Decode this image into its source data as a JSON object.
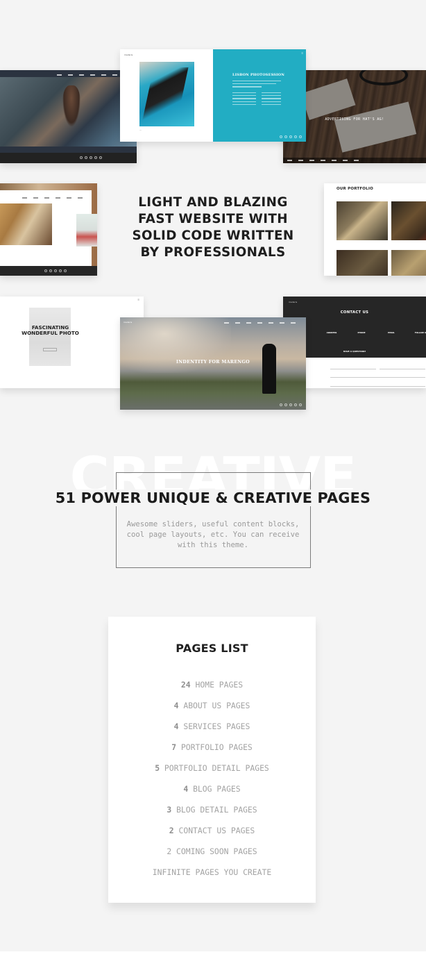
{
  "colors": {
    "background": "#f4f4f4",
    "accent_teal": "#22adc3",
    "heading": "#1e1e1e",
    "muted_text": "#a3a3a3",
    "outline": "#7a7a7a"
  },
  "showcase": {
    "lisbon": {
      "brand": "madaris",
      "title": "LISBON PHOTOSESSION"
    },
    "survival": {
      "headline": "ADVERTISING FOR HAT'S AG!"
    },
    "portfolio": {
      "title": "OUR PORTFOLIO"
    },
    "fascinating": {
      "title_line1": "FASCINATING",
      "title_line2": "WONDERFUL PHOTO"
    },
    "marengo": {
      "brand": "madaris",
      "title": "INDENTITY FOR MARENGO"
    },
    "contact": {
      "brand": "madaris",
      "title": "CONTACT US",
      "columns": [
        "ADDRESS",
        "PHONE",
        "EMAIL",
        "FOLLOW US"
      ],
      "question": "HAVE A QUESTION?"
    }
  },
  "hero": {
    "lines": [
      "LIGHT AND BLAZING",
      "FAST WEBSITE WITH",
      "SOLID CODE WRITTEN",
      "BY PROFESSIONALS"
    ]
  },
  "creative": {
    "watermark": "CREATIVE",
    "title": "51 POWER UNIQUE & CREATIVE PAGES",
    "description": "Awesome sliders, useful content blocks, cool page layouts, etc. You can receive with this theme."
  },
  "pages_list": {
    "title": "PAGES LIST",
    "items": [
      {
        "count": "24",
        "label": "HOME PAGES"
      },
      {
        "count": "4",
        "label": "ABOUT US PAGES"
      },
      {
        "count": "4",
        "label": "SERVICES PAGES"
      },
      {
        "count": "7",
        "label": "PORTFOLIO PAGES"
      },
      {
        "count": "5",
        "label": "PORTFOLIO DETAIL PAGES"
      },
      {
        "count": "4",
        "label": "BLOG PAGES"
      },
      {
        "count": "3",
        "label": "BLOG DETAIL PAGES"
      },
      {
        "count": "2",
        "label": "CONTACT US PAGES"
      },
      {
        "count": "",
        "label": "2 COMING SOON PAGES"
      },
      {
        "count": "",
        "label": "INFINITE PAGES YOU CREATE"
      }
    ]
  }
}
